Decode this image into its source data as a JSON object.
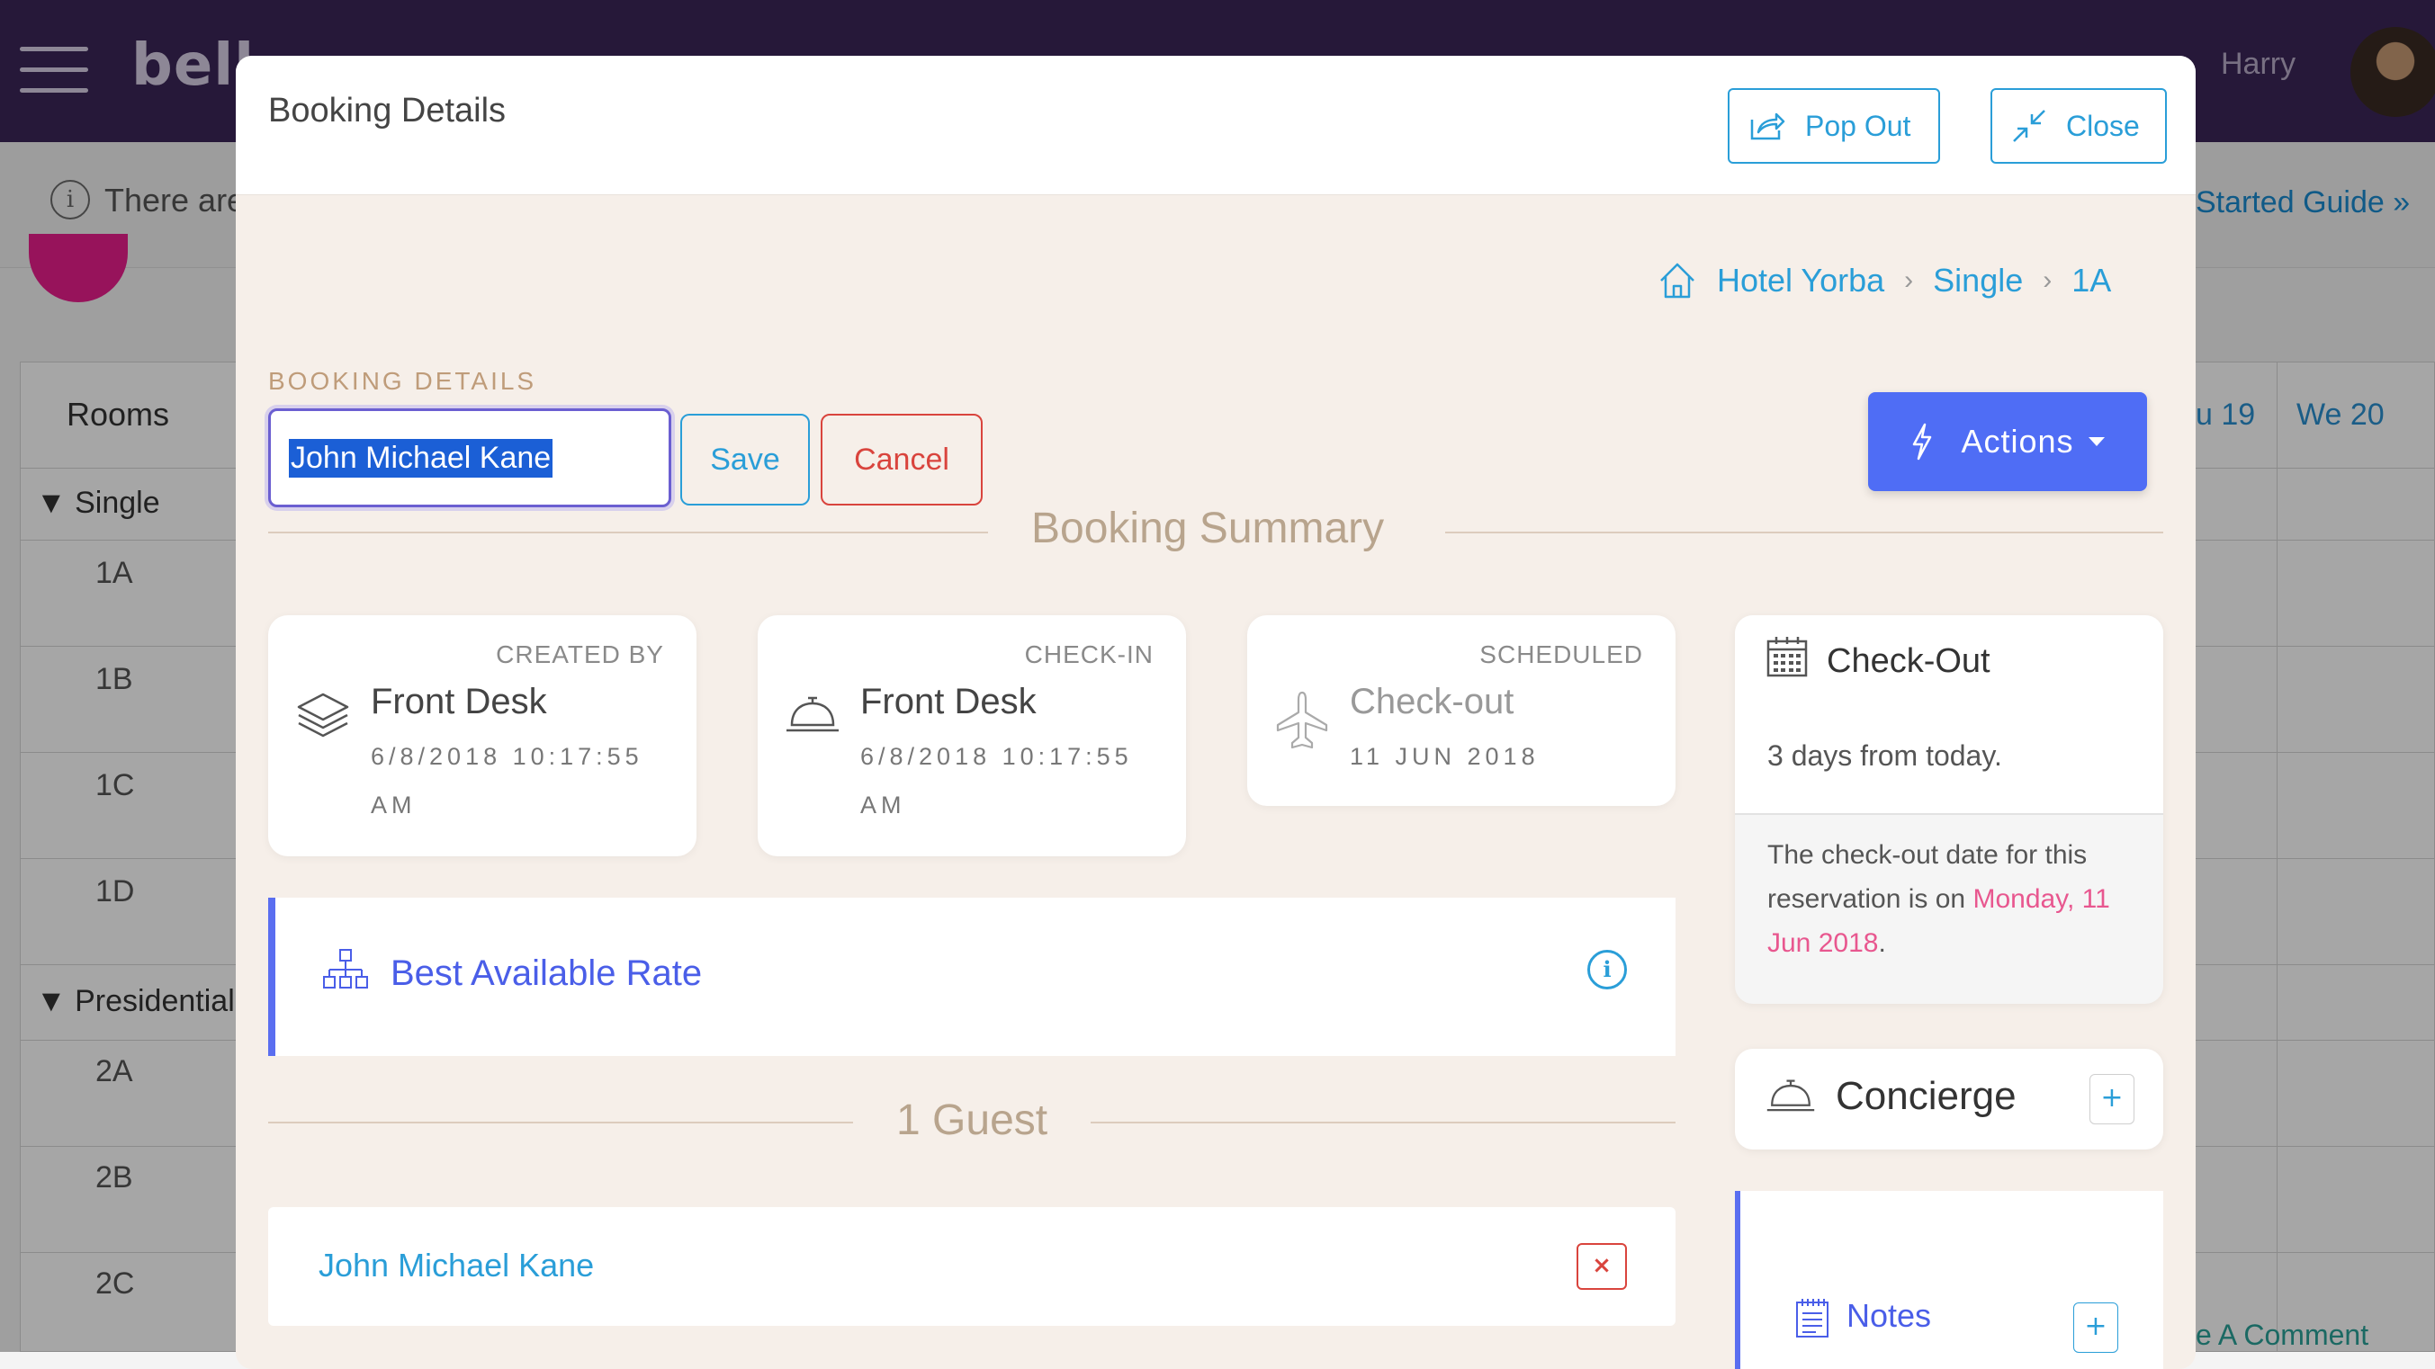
{
  "app": {
    "brand": "bell",
    "user_name": "Harry"
  },
  "notice": {
    "text": "There are",
    "guide_link": "Started Guide »",
    "comment_link": "e A Comment"
  },
  "scheduler": {
    "rooms_header": "Rooms",
    "days": [
      "u 19",
      "We 20"
    ],
    "groups": [
      {
        "name": "▼ Single",
        "rooms": [
          "1A",
          "1B",
          "1C",
          "1D"
        ]
      },
      {
        "name": "▼ Presidential",
        "rooms": [
          "2A",
          "2B",
          "2C"
        ]
      }
    ]
  },
  "modal": {
    "title": "Booking Details",
    "pop_out_label": "Pop Out",
    "close_label": "Close",
    "breadcrumb": {
      "hotel": "Hotel Yorba",
      "room_type": "Single",
      "room": "1A",
      "separator": "›"
    },
    "section_label": "BOOKING DETAILS",
    "name_input_value": "John Michael Kane",
    "save_label": "Save",
    "cancel_label": "Cancel",
    "actions_label": "Actions",
    "summary_title": "Booking Summary",
    "cards": {
      "created": {
        "label": "CREATED BY",
        "main": "Front Desk",
        "sub": "6/8/2018 10:17:55 AM"
      },
      "checkin": {
        "label": "CHECK-IN",
        "main": "Front Desk",
        "sub": "6/8/2018 10:17:55 AM"
      },
      "scheduled": {
        "label": "SCHEDULED",
        "main": "Check-out",
        "sub": "11 JUN 2018"
      }
    },
    "rate": {
      "label": "Best Available Rate"
    },
    "guests_title": "1 Guest",
    "guests": [
      {
        "name": "John Michael Kane"
      }
    ],
    "remove_label": "×",
    "checkout": {
      "title": "Check-Out",
      "days": "3 days from today.",
      "body": "The check-out date for this reservation is on",
      "date": "Monday, 11 Jun 2018",
      "period": "."
    },
    "concierge": {
      "label": "Concierge",
      "add": "+"
    },
    "notes": {
      "label": "Notes",
      "add": "+"
    }
  },
  "colors": {
    "topbar": "#3b2658",
    "accent_blue": "#2a9ed8",
    "actions_blue": "#4f6df5",
    "danger": "#d9443d",
    "date_pink": "#e8578f",
    "modal_bg": "#f6efe9"
  }
}
